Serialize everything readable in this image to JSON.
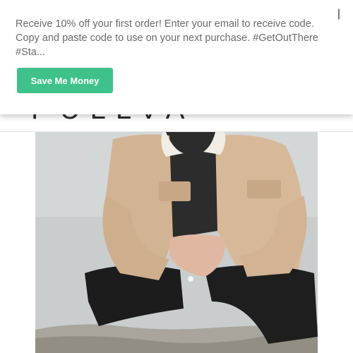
{
  "site": {
    "logo_text": "PULLVA"
  },
  "promo": {
    "message": "Receive 10% off your first order! Enter your email to receive code. Copy and paste code to use on your next purchase. #GetOutThere #Sta...",
    "button_label": "Save Me Money",
    "close_glyph": "|",
    "accent_color": "#3ec28a"
  },
  "hero": {
    "icon": "product-photo"
  }
}
